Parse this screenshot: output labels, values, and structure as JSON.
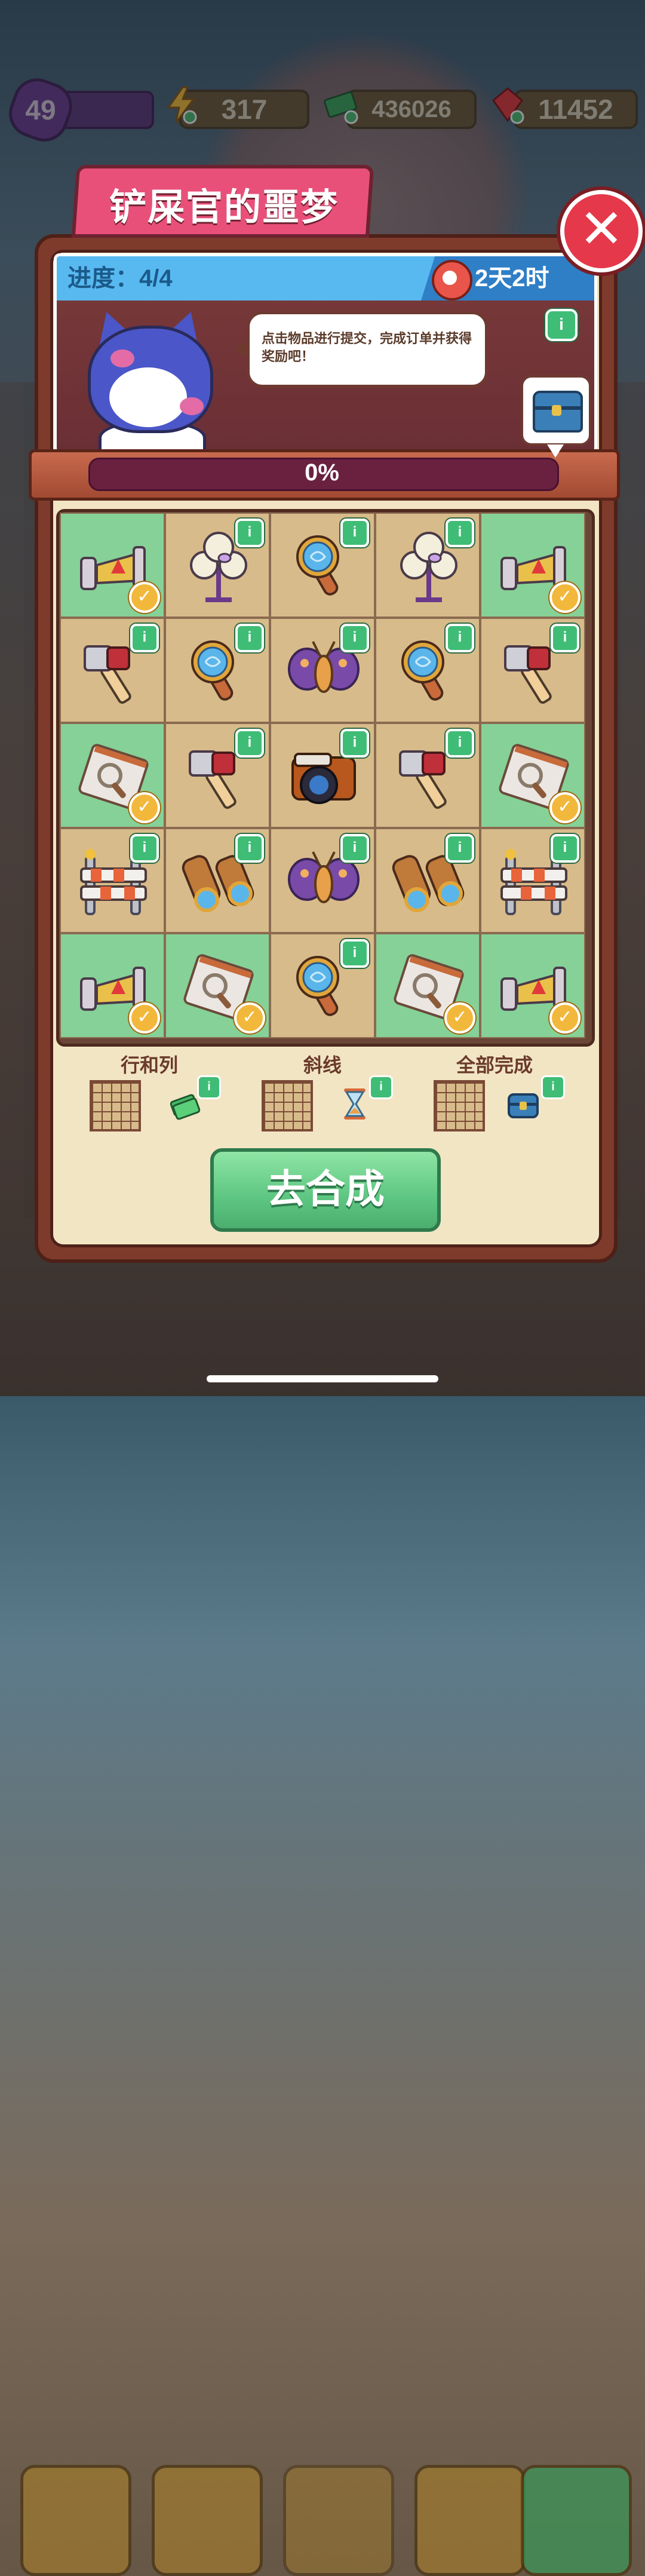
{
  "hud": {
    "level": "49",
    "energy": "317",
    "cash": "436026",
    "gems": "11452"
  },
  "dialog": {
    "title": "铲屎官的噩梦",
    "close_icon": "close-icon",
    "progress_label": "进度：",
    "progress_value": "4/4",
    "timer": "2天2时",
    "speech": "点击物品进行提交，完成订单并获得奖励吧！",
    "percent": "0%"
  },
  "grid": {
    "cells": [
      {
        "item": "warning-sign-icon",
        "state": "done"
      },
      {
        "item": "lamp-moth-icon",
        "state": "todo"
      },
      {
        "item": "magnifier-icon",
        "state": "todo"
      },
      {
        "item": "lamp-moth-icon",
        "state": "todo"
      },
      {
        "item": "warning-sign-icon",
        "state": "done"
      },
      {
        "item": "hammer-icon",
        "state": "todo"
      },
      {
        "item": "magnifier-icon",
        "state": "todo"
      },
      {
        "item": "moth-icon",
        "state": "todo"
      },
      {
        "item": "magnifier-icon",
        "state": "todo"
      },
      {
        "item": "hammer-icon",
        "state": "todo"
      },
      {
        "item": "evidence-bag-icon",
        "state": "done"
      },
      {
        "item": "hammer-icon",
        "state": "todo"
      },
      {
        "item": "camera-icon",
        "state": "todo"
      },
      {
        "item": "hammer-icon",
        "state": "todo"
      },
      {
        "item": "evidence-bag-icon",
        "state": "done"
      },
      {
        "item": "barrier-icon",
        "state": "todo"
      },
      {
        "item": "binoculars-icon",
        "state": "todo"
      },
      {
        "item": "moth-icon",
        "state": "todo"
      },
      {
        "item": "binoculars-icon",
        "state": "todo"
      },
      {
        "item": "barrier-icon",
        "state": "todo"
      },
      {
        "item": "warning-sign-icon",
        "state": "done"
      },
      {
        "item": "evidence-bag-icon",
        "state": "done"
      },
      {
        "item": "magnifier-icon",
        "state": "todo"
      },
      {
        "item": "evidence-bag-icon",
        "state": "done"
      },
      {
        "item": "warning-sign-icon",
        "state": "done"
      }
    ]
  },
  "rewards": [
    {
      "label": "行和列",
      "icon": "cash-icon"
    },
    {
      "label": "斜线",
      "icon": "hourglass-icon"
    },
    {
      "label": "全部完成",
      "icon": "chest-icon"
    }
  ],
  "go_button": "去合成",
  "colors": {
    "done_cell": "#86d197",
    "todo_cell": "#d8bb8a",
    "title_tab": "#e8507a",
    "go_button": "#5dc682",
    "close_button": "#e5384a"
  }
}
